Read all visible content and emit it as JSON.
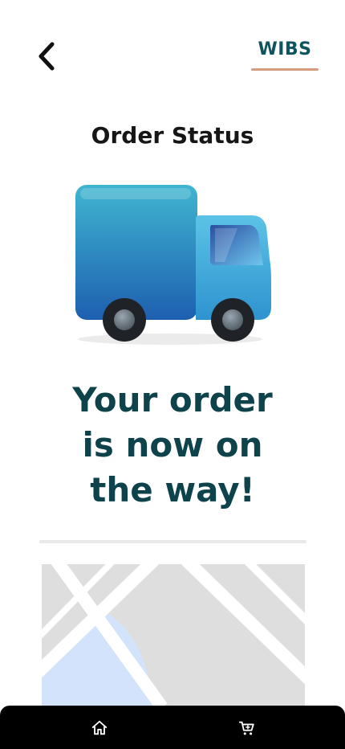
{
  "header": {
    "back_icon": "chevron-left-icon",
    "brand": "WIBS",
    "brand_color": "#0f5560",
    "brand_underline_color": "#d49b7d"
  },
  "page": {
    "title": "Order Status",
    "illustration": "delivery-truck-icon",
    "headline_lines": [
      "Your order",
      "is now on",
      "the way!"
    ],
    "headline_color": "#0e434b"
  },
  "map": {
    "icon": "map-preview",
    "background_color": "#dedede"
  },
  "bottom_nav": {
    "items": [
      {
        "icon": "home-icon"
      },
      {
        "icon": "cart-icon"
      }
    ]
  }
}
